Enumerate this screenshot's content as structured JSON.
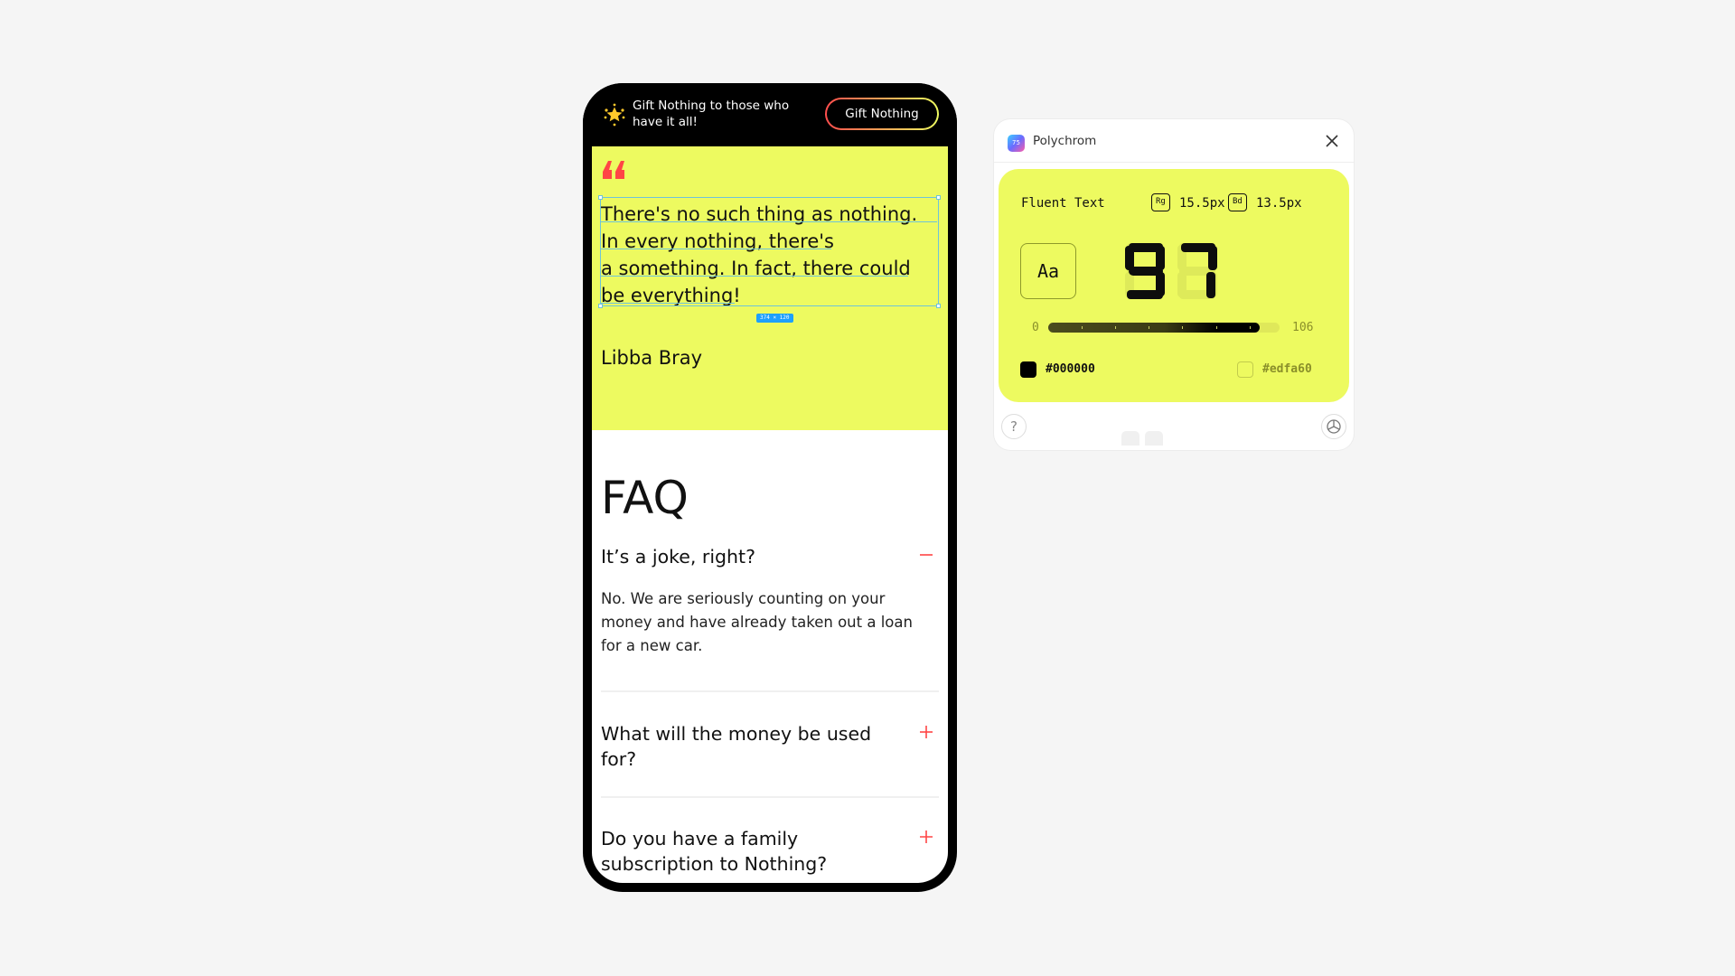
{
  "phone": {
    "banner": {
      "text": "Gift Nothing to those who have it all!",
      "button_label": "Gift Nothing",
      "icon": "star-icon"
    },
    "quote": {
      "lines": [
        "There's no such thing as nothing.",
        "In every nothing, there's",
        "a something. In fact, there could",
        "be everything!"
      ],
      "author": "Libba Bray",
      "selection_size": "374 × 120",
      "accent_color": "#ff4545",
      "background": "#edfa60"
    },
    "faq": {
      "title": "FAQ",
      "items": [
        {
          "question": "It’s a joke, right?",
          "answer": "No. We are seriously counting on your money and have already taken out a loan for a new car.",
          "expanded": true,
          "toggle": "minus-icon"
        },
        {
          "question": "What will the money be used for?",
          "expanded": false,
          "toggle": "plus-icon"
        },
        {
          "question": "Do you have a family subscription to Nothing?",
          "expanded": false,
          "toggle": "plus-icon"
        }
      ]
    }
  },
  "polychrom": {
    "title": "Polychrom",
    "logo_text": "75",
    "mode_label": "Fluent Text",
    "regular_badge": "Rg",
    "regular_size": "15.5px",
    "bold_badge": "Bd",
    "bold_size": "13.5px",
    "sample_label": "Aa",
    "score": "97",
    "slider": {
      "min": "0",
      "max": "106",
      "value": 97
    },
    "foreground_hex": "#000000",
    "background_hex": "#edfa60",
    "help_label": "?"
  }
}
